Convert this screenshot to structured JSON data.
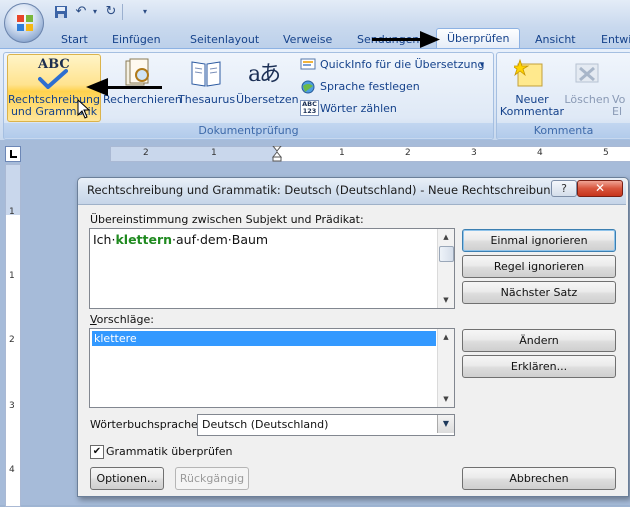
{
  "tabs": [
    "Start",
    "Einfügen",
    "Seitenlayout",
    "Verweise",
    "Sendungen",
    "Überprüfen",
    "Ansicht",
    "Entwi"
  ],
  "active_tab": "Überprüfen",
  "ribbon": {
    "group1": {
      "label": "Dokumentprüfung",
      "spelling_icon_text": "ABC",
      "spelling_line1": "Rechtschreibung",
      "spelling_line2": "und Grammatik",
      "research": "Recherchieren",
      "thesaurus": "Thesaurus",
      "translate": "Übersetzen",
      "translate_icon_text": "aあ",
      "quickinfo": "QuickInfo für die Übersetzung",
      "language": "Sprache festlegen",
      "wordcount": "Wörter zählen",
      "wordcount_icon_text": "ABC\n123"
    },
    "group2": {
      "label": "Kommenta",
      "new_comment_line1": "Neuer",
      "new_comment_line2": "Kommentar",
      "delete": "Löschen",
      "prev_line1": "Vo",
      "prev_line2": "El"
    }
  },
  "ruler": {
    "top_numbers": [
      "2",
      "1",
      "1",
      "2",
      "3",
      "4",
      "5"
    ],
    "left_numbers": [
      "1",
      "1",
      "2",
      "3",
      "4"
    ]
  },
  "dialog": {
    "title": "Rechtschreibung und Grammatik: Deutsch (Deutschland) - Neue Rechtschreibung",
    "help": "?",
    "close": "✕",
    "issue_label": "Übereinstimmung zwischen Subjekt und Prädikat:",
    "sentence_before": "Ich·",
    "sentence_error": "klettern",
    "sentence_after": "·auf·dem·Baum",
    "suggestions_label": "Vorschläge:",
    "suggestions": [
      "klettere"
    ],
    "dictionary_label": "Wörterbuchsprache:",
    "dictionary_value": "Deutsch (Deutschland)",
    "grammar_check_label": "Grammatik überprüfen",
    "grammar_check_checked": true,
    "buttons": {
      "ignore_once": "Einmal ignorieren",
      "ignore_rule": "Regel ignorieren",
      "next_sentence": "Nächster Satz",
      "change": "Ändern",
      "explain": "Erklären...",
      "options": "Optionen...",
      "undo": "Rückgängig",
      "cancel": "Abbrechen"
    }
  }
}
